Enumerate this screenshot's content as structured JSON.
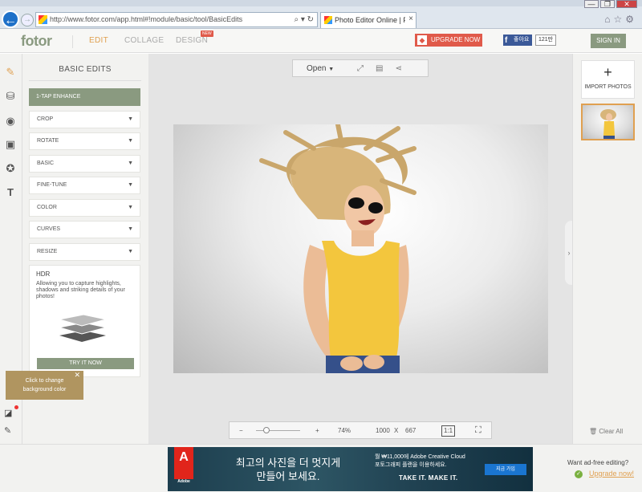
{
  "browser": {
    "url": "http://www.fotor.com/app.html#!module/basic/tool/BasicEdits",
    "tab_title": "Photo Editor Online | Fotor...",
    "addr_tools": "⌕ ▾ ↻",
    "winctl": [
      "—",
      "❐",
      "✕"
    ]
  },
  "header": {
    "logo": "fotor",
    "nav": {
      "edit": "EDIT",
      "collage": "COLLAGE",
      "design": "DESIGN",
      "new_badge": "NEW"
    },
    "upgrade_label": "UPGRADE NOW",
    "fb_label": "좋아요",
    "fb_count": "121만",
    "signin_label": "SIGN IN"
  },
  "panel": {
    "title": "BASIC EDITS",
    "enhance_label": "1-TAP ENHANCE",
    "items": [
      "CROP",
      "ROTATE",
      "BASIC",
      "FINE-TUNE",
      "COLOR",
      "CURVES",
      "RESIZE"
    ],
    "hdr": {
      "title": "HDR",
      "description": "Allowing you to capture highlights, shadows and striking details of your photos!",
      "button": "TRY IT NOW"
    }
  },
  "tooltip": {
    "text_line1": "Click to change",
    "text_line2": "background color"
  },
  "toolbar": {
    "open_label": "Open"
  },
  "zoom": {
    "minus": "−",
    "plus": "+",
    "percent": "74%",
    "width": "1000",
    "x": "X",
    "height": "667",
    "fit": "1:1"
  },
  "right": {
    "import_plus": "+",
    "import_label": "IMPORT PHOTOS",
    "clear_label": "Clear All"
  },
  "footer": {
    "ad": {
      "adobe": "Adobe",
      "headline_line1": "최고의 사진을 더 멋지게",
      "headline_line2": "만들어 보세요.",
      "price_line1": "월 ₩11,000에 Adobe Creative Cloud",
      "price_line2": "포토그래피 플랜을 이용하세요.",
      "join": "지금 가입",
      "tagline": "TAKE IT. MAKE IT."
    },
    "want": "Want ad-free editing?",
    "upgrade": "Upgrade now!"
  },
  "colors": {
    "brand_green": "#8a9a80",
    "accent_orange": "#e0a050",
    "upgrade_red": "#e05a4a",
    "tooltip_gold": "#b09560"
  }
}
